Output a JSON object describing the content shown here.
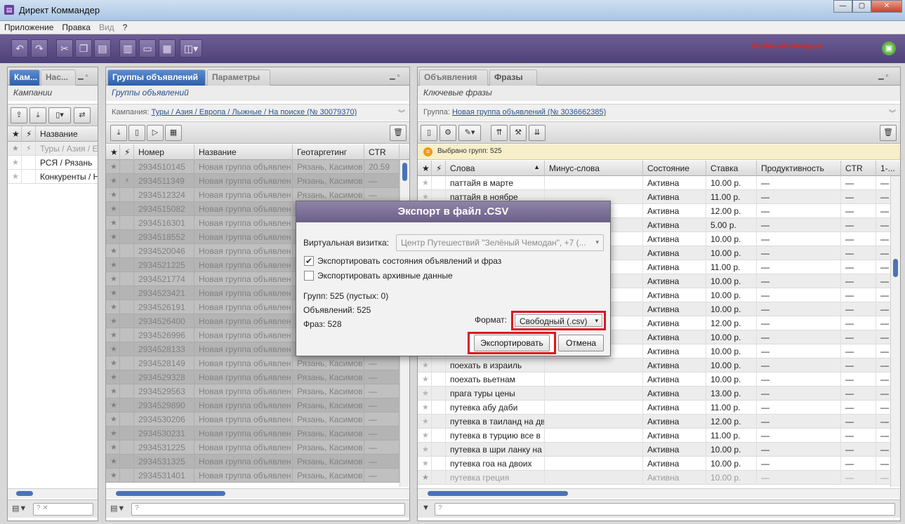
{
  "window": {
    "title": "Директ Коммандер",
    "controls": [
      "—",
      "▢",
      "✕"
    ]
  },
  "menu": [
    {
      "label": "Приложение",
      "disabled": false
    },
    {
      "label": "Правка",
      "disabled": false
    },
    {
      "label": "Вид",
      "disabled": true
    },
    {
      "label": "?",
      "disabled": false
    }
  ],
  "toolbar": {
    "right_label": "Зелёный Чемодан"
  },
  "campaigns_panel": {
    "tabs": [
      "Кам...",
      "Нас..."
    ],
    "subtitle": "Кампании",
    "columns": [
      "Название"
    ],
    "rows": [
      {
        "name": "Туры / Азия / Е",
        "bolt": true,
        "dim": true
      },
      {
        "name": "РСЯ / Рязань",
        "bolt": false,
        "dim": false
      },
      {
        "name": "Конкуренты / Н",
        "bolt": false,
        "dim": false
      }
    ]
  },
  "groups_panel": {
    "tabs": [
      "Группы объявлений",
      "Параметры"
    ],
    "subtitle": "Группы объявлений",
    "crumb_label": "Кампания:",
    "crumb_link": "Туры / Азия / Европа / Лыжные / На поиске (№ 30079370)",
    "columns": [
      "Номер",
      "Название",
      "Геотаргетинг",
      "CTR"
    ],
    "rows": [
      {
        "id": "2934510145",
        "name": "Новая группа объявлен",
        "geo": "Рязань, Касимов",
        "ctr": "20.59",
        "bolt": false
      },
      {
        "id": "2934511349",
        "name": "Новая группа объявлен",
        "geo": "Рязань, Касимов",
        "ctr": "—",
        "bolt": true
      },
      {
        "id": "2934512324",
        "name": "Новая группа объявлен",
        "geo": "Рязань, Касимов",
        "ctr": "—",
        "bolt": false
      },
      {
        "id": "2934515082",
        "name": "Новая группа объявлен",
        "geo": "Рязань, Касимов",
        "ctr": "—",
        "bolt": false
      },
      {
        "id": "2934516301",
        "name": "Новая группа объявлен",
        "geo": "Рязань, Касимов",
        "ctr": "—",
        "bolt": false
      },
      {
        "id": "2934518552",
        "name": "Новая группа объявлен",
        "geo": "Рязань, Касимов",
        "ctr": "—",
        "bolt": false
      },
      {
        "id": "2934520046",
        "name": "Новая группа объявлен",
        "geo": "Рязань, Касимов",
        "ctr": "—",
        "bolt": false
      },
      {
        "id": "2934521225",
        "name": "Новая группа объявлен",
        "geo": "Рязань, Касимов",
        "ctr": "—",
        "bolt": false
      },
      {
        "id": "2934521774",
        "name": "Новая группа объявлен",
        "geo": "Рязань, Касимов",
        "ctr": "—",
        "bolt": false
      },
      {
        "id": "2934523421",
        "name": "Новая группа объявлен",
        "geo": "Рязань, Касимов",
        "ctr": "—",
        "bolt": false
      },
      {
        "id": "2934526191",
        "name": "Новая группа объявлен",
        "geo": "Рязань, Касимов",
        "ctr": "—",
        "bolt": false
      },
      {
        "id": "2934526400",
        "name": "Новая группа объявлен",
        "geo": "Рязань, Касимов",
        "ctr": "—",
        "bolt": false
      },
      {
        "id": "2934526996",
        "name": "Новая группа объявлен",
        "geo": "Рязань, Касимов",
        "ctr": "—",
        "bolt": false
      },
      {
        "id": "2934528133",
        "name": "Новая группа объявлен",
        "geo": "Рязань, Касимов",
        "ctr": "—",
        "bolt": false
      },
      {
        "id": "2934528149",
        "name": "Новая группа объявлен",
        "geo": "Рязань, Касимов",
        "ctr": "—",
        "bolt": false
      },
      {
        "id": "2934529328",
        "name": "Новая группа объявлен",
        "geo": "Рязань, Касимов",
        "ctr": "—",
        "bolt": false
      },
      {
        "id": "2934529563",
        "name": "Новая группа объявлен",
        "geo": "Рязань, Касимов",
        "ctr": "—",
        "bolt": false
      },
      {
        "id": "2934529890",
        "name": "Новая группа объявлен",
        "geo": "Рязань, Касимов",
        "ctr": "—",
        "bolt": false
      },
      {
        "id": "2934530206",
        "name": "Новая группа объявлен",
        "geo": "Рязань, Касимов",
        "ctr": "—",
        "bolt": false
      },
      {
        "id": "2934530231",
        "name": "Новая группа объявлен",
        "geo": "Рязань, Касимов",
        "ctr": "—",
        "bolt": false
      },
      {
        "id": "2934531225",
        "name": "Новая группа объявлен",
        "geo": "Рязань, Касимов",
        "ctr": "—",
        "bolt": false
      },
      {
        "id": "2934531325",
        "name": "Новая группа объявлен",
        "geo": "Рязань, Касимов",
        "ctr": "—",
        "bolt": false
      },
      {
        "id": "2934531401",
        "name": "Новая группа объявлен",
        "geo": "Рязань, Касимов",
        "ctr": "—",
        "bolt": false
      }
    ]
  },
  "phrases_panel": {
    "tabs": [
      "Объявления",
      "Фразы"
    ],
    "subtitle": "Ключевые фразы",
    "crumb_label": "Группа:",
    "crumb_link": "Новая группа объявлений (№ 3036662385)",
    "banner": "Выбрано групп: 525",
    "columns": [
      "Слова",
      "Минус-слова",
      "Состояние",
      "Ставка",
      "Продуктивность",
      "CTR",
      "1-..."
    ],
    "rows": [
      {
        "word": "паттайя в марте",
        "state": "Активна",
        "bid": "10.00 р.",
        "prod": "—",
        "ctr": "—",
        "dim": false
      },
      {
        "word": "паттайя в ноябре",
        "state": "Активна",
        "bid": "11.00 р.",
        "prod": "—",
        "ctr": "—",
        "dim": false
      },
      {
        "word": "",
        "state": "Активна",
        "bid": "12.00 р.",
        "prod": "—",
        "ctr": "—",
        "dim": false
      },
      {
        "word": "",
        "state": "Активна",
        "bid": "5.00 р.",
        "prod": "—",
        "ctr": "—",
        "dim": false
      },
      {
        "word": "",
        "state": "Активна",
        "bid": "10.00 р.",
        "prod": "—",
        "ctr": "—",
        "dim": false
      },
      {
        "word": "",
        "state": "Активна",
        "bid": "10.00 р.",
        "prod": "—",
        "ctr": "—",
        "dim": false
      },
      {
        "word": "",
        "state": "Активна",
        "bid": "11.00 р.",
        "prod": "—",
        "ctr": "—",
        "dim": false
      },
      {
        "word": "",
        "state": "Активна",
        "bid": "10.00 р.",
        "prod": "—",
        "ctr": "—",
        "dim": false
      },
      {
        "word": "",
        "state": "Активна",
        "bid": "10.00 р.",
        "prod": "—",
        "ctr": "—",
        "dim": false
      },
      {
        "word": "",
        "state": "Активна",
        "bid": "10.00 р.",
        "prod": "—",
        "ctr": "—",
        "dim": false
      },
      {
        "word": "",
        "state": "Активна",
        "bid": "12.00 р.",
        "prod": "—",
        "ctr": "—",
        "dim": false
      },
      {
        "word": "",
        "state": "Активна",
        "bid": "10.00 р.",
        "prod": "—",
        "ctr": "—",
        "dim": false
      },
      {
        "word": "",
        "state": "Активна",
        "bid": "10.00 р.",
        "prod": "—",
        "ctr": "—",
        "dim": false
      },
      {
        "word": "поехать в израиль",
        "state": "Активна",
        "bid": "10.00 р.",
        "prod": "—",
        "ctr": "—",
        "dim": false
      },
      {
        "word": "поехать вьетнам",
        "state": "Активна",
        "bid": "10.00 р.",
        "prod": "—",
        "ctr": "—",
        "dim": false
      },
      {
        "word": "прага туры цены",
        "state": "Активна",
        "bid": "13.00 р.",
        "prod": "—",
        "ctr": "—",
        "dim": false
      },
      {
        "word": "путевка абу даби",
        "state": "Активна",
        "bid": "11.00 р.",
        "prod": "—",
        "ctr": "—",
        "dim": false
      },
      {
        "word": "путевка в таиланд на дв",
        "state": "Активна",
        "bid": "12.00 р.",
        "prod": "—",
        "ctr": "—",
        "dim": false
      },
      {
        "word": "путевка в турцию все в",
        "state": "Активна",
        "bid": "11.00 р.",
        "prod": "—",
        "ctr": "—",
        "dim": false
      },
      {
        "word": "путевка в шри ланку на",
        "state": "Активна",
        "bid": "10.00 р.",
        "prod": "—",
        "ctr": "—",
        "dim": false
      },
      {
        "word": "путевка гоа на двоих",
        "state": "Активна",
        "bid": "10.00 р.",
        "prod": "—",
        "ctr": "—",
        "dim": false
      },
      {
        "word": "путевка греция",
        "state": "Активна",
        "bid": "10.00 р.",
        "prod": "—",
        "ctr": "—",
        "dim": true
      }
    ]
  },
  "dialog": {
    "title": "Экспорт в файл .CSV",
    "vcard_label": "Виртуальная визитка:",
    "vcard_value": "Центр Путешествий \"Зелёный Чемодан\", +7 (...",
    "check_states_label": "Экспортировать состояния объявлений и фраз",
    "check_states": true,
    "check_archive_label": "Экспортировать архивные данные",
    "check_archive": false,
    "groups_stat": "Групп: 525 (пустых: 0)",
    "ads_stat": "Объявлений: 525",
    "phrases_stat": "Фраз: 528",
    "format_label": "Формат:",
    "format_value": "Свободный (.csv)",
    "export_button": "Экспортировать",
    "cancel_button": "Отмена"
  }
}
